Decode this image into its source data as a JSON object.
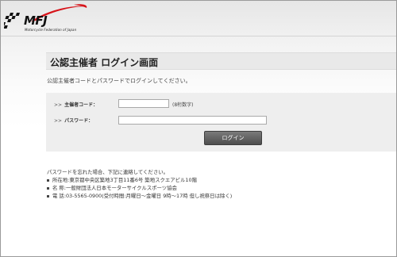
{
  "header": {
    "logo_text": "MFJ",
    "logo_subtext": "Motorcycle Federation of Japan"
  },
  "page": {
    "title": "公認主催者 ログイン画面",
    "intro": "公認主催者コードとパスワードでログインしてください。"
  },
  "form": {
    "code_label": "主催者コード：",
    "code_value": "",
    "code_hint": "(8桁数字)",
    "password_label": "パスワード：",
    "password_value": "",
    "login_button": "ログイン",
    "label_prefix": ">>"
  },
  "contact": {
    "intro": "パスワードを忘れた場合、下記に連絡してください。",
    "address": "所在地:東京都中央区築地3丁目11番6号 築地スクエアビル10階",
    "name": "名 称:一般財団法人日本モーターサイクルスポーツ協会",
    "phone": "電 話:03-5565-0900(受付時間:月曜日～金曜日 9時～17時 但し祝祭日は除く)"
  },
  "colors": {
    "logo_red": "#d7141a",
    "logo_black": "#111111",
    "button_bg": "#5e5e5e",
    "panel_bg": "#eeeeee",
    "title_bar_bg": "#e9e9e9"
  }
}
